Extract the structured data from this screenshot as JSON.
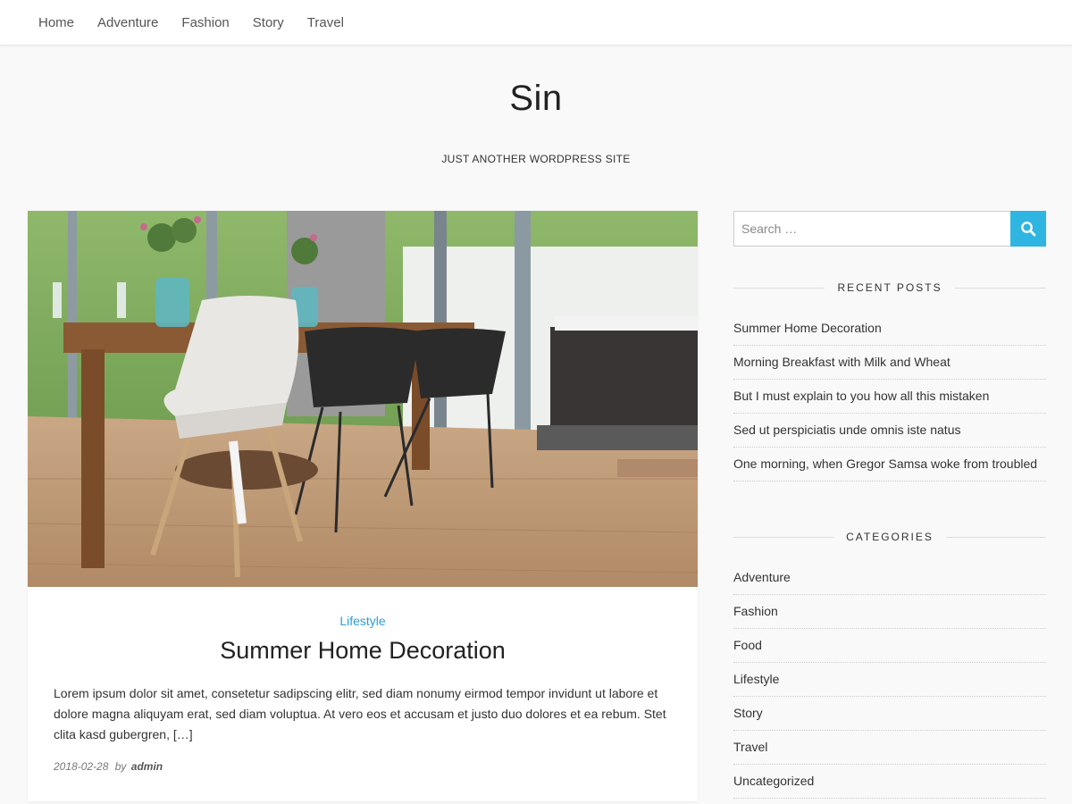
{
  "nav": {
    "items": [
      "Home",
      "Adventure",
      "Fashion",
      "Story",
      "Travel"
    ]
  },
  "site": {
    "title": "Sin",
    "description": "JUST ANOTHER WORDPRESS SITE"
  },
  "post": {
    "category": "Lifestyle",
    "title": "Summer Home Decoration",
    "excerpt": "Lorem ipsum dolor sit amet, consetetur sadipscing elitr, sed diam nonumy eirmod tempor invidunt ut labore et dolore magna aliquyam erat, sed diam voluptua. At vero eos et accusam et justo duo dolores et ea rebum. Stet clita kasd gubergren, […]",
    "date": "2018-02-28",
    "by": "by",
    "author": "admin"
  },
  "search": {
    "placeholder": "Search …",
    "value": ""
  },
  "recent_posts": {
    "title": "RECENT POSTS",
    "items": [
      "Summer Home Decoration",
      "Morning Breakfast with Milk and Wheat",
      "But I must explain to you how all this mistaken",
      "Sed ut perspiciatis unde omnis iste natus",
      "One morning, when Gregor Samsa woke from troubled"
    ]
  },
  "categories": {
    "title": "CATEGORIES",
    "items": [
      "Adventure",
      "Fashion",
      "Food",
      "Lifestyle",
      "Story",
      "Travel",
      "Uncategorized"
    ]
  },
  "colors": {
    "accent": "#2fb5e1",
    "category_link": "#2a9fd6"
  }
}
